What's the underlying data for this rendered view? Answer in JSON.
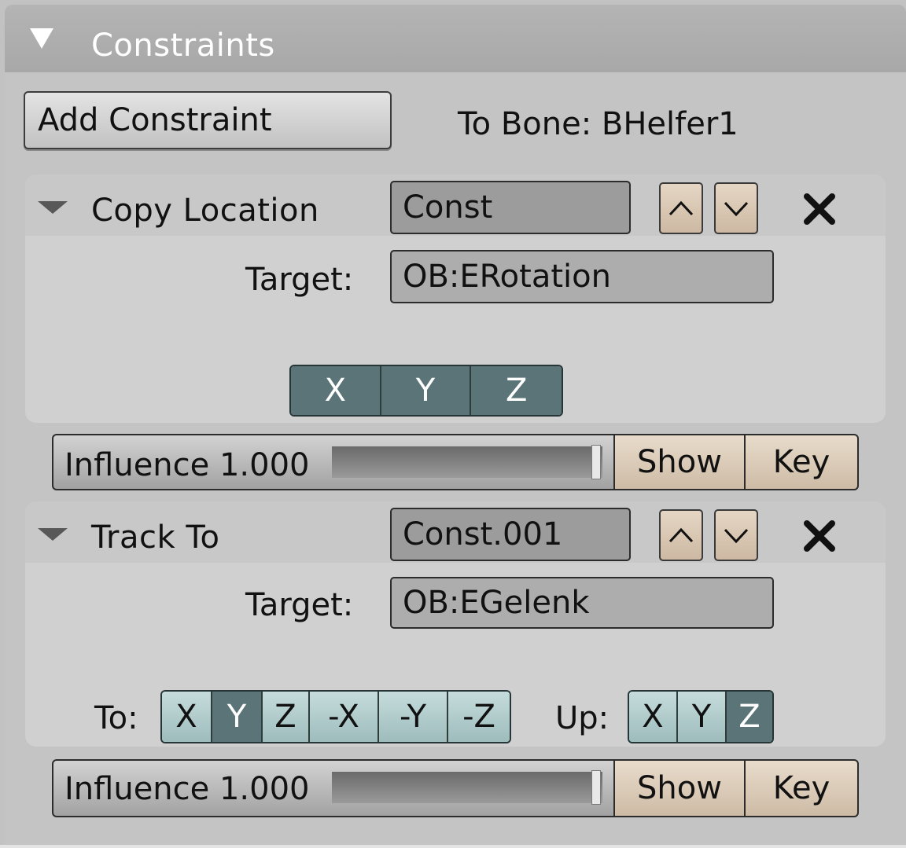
{
  "panel": {
    "title": "Constraints"
  },
  "add_constraint_label": "Add Constraint",
  "to_bone_label": "To Bone: BHelfer1",
  "constraints": [
    {
      "type": "Copy Location",
      "name": "Const",
      "target_label": "Target:",
      "target": "OB:ERotation",
      "axes": [
        "X",
        "Y",
        "Z"
      ],
      "axes_active": [
        true,
        true,
        true
      ],
      "influence_label": "Influence 1.000",
      "influence_value": 1.0,
      "show_label": "Show",
      "key_label": "Key"
    },
    {
      "type": "Track To",
      "name": "Const.001",
      "target_label": "Target:",
      "target": "OB:EGelenk",
      "to_label": "To:",
      "to_options": [
        "X",
        "Y",
        "Z",
        "-X",
        "-Y",
        "-Z"
      ],
      "to_selected": "Y",
      "up_label": "Up:",
      "up_options": [
        "X",
        "Y",
        "Z"
      ],
      "up_selected": "Z",
      "influence_label": "Influence 1.000",
      "influence_value": 1.0,
      "show_label": "Show",
      "key_label": "Key"
    }
  ],
  "icons": {
    "panel_collapse": "triangle-down-icon",
    "block_collapse": "triangle-down-icon",
    "move_up": "chevron-up-icon",
    "move_down": "chevron-down-icon",
    "delete": "close-icon"
  },
  "colors": {
    "toggle_on": "#5a7478",
    "toggle_off": "#b2cccc",
    "button_tan": "#dccab6"
  }
}
